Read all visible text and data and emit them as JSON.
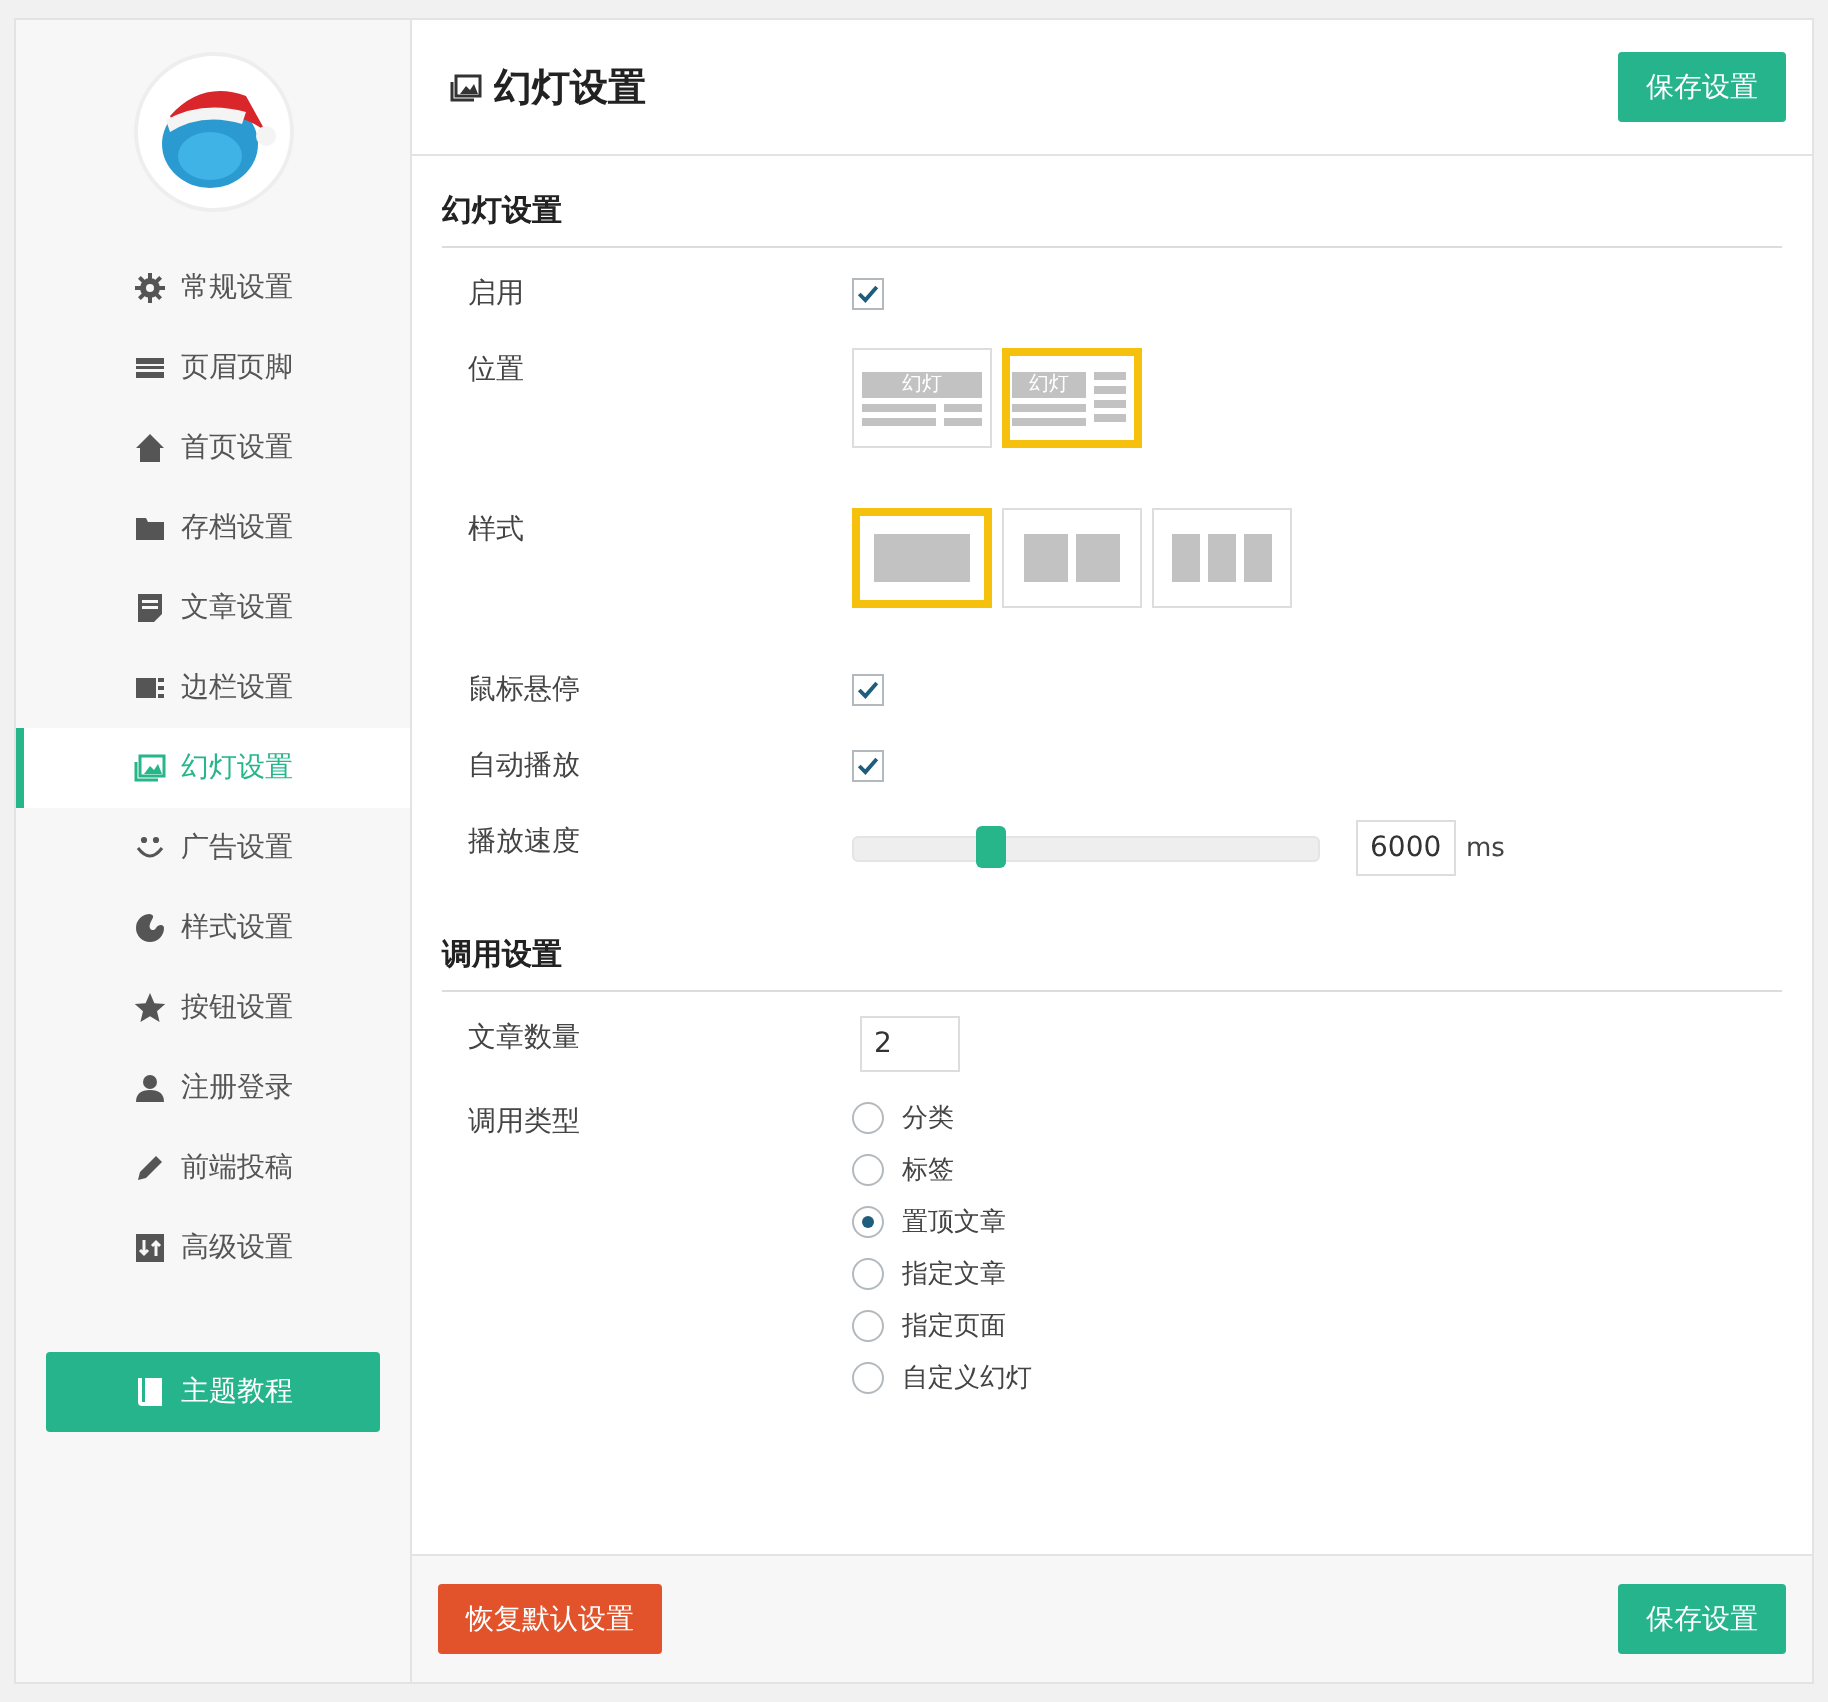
{
  "sidebar": {
    "items": [
      {
        "label": "常规设置",
        "selected": false
      },
      {
        "label": "页眉页脚",
        "selected": false
      },
      {
        "label": "首页设置",
        "selected": false
      },
      {
        "label": "存档设置",
        "selected": false
      },
      {
        "label": "文章设置",
        "selected": false
      },
      {
        "label": "边栏设置",
        "selected": false
      },
      {
        "label": "幻灯设置",
        "selected": true
      },
      {
        "label": "广告设置",
        "selected": false
      },
      {
        "label": "样式设置",
        "selected": false
      },
      {
        "label": "按钮设置",
        "selected": false
      },
      {
        "label": "注册登录",
        "selected": false
      },
      {
        "label": "前端投稿",
        "selected": false
      },
      {
        "label": "高级设置",
        "selected": false
      }
    ],
    "tutorial_button": "主题教程"
  },
  "header": {
    "title": "幻灯设置",
    "save_button": "保存设置"
  },
  "sections": [
    {
      "heading": "幻灯设置",
      "rows": [
        {
          "kind": "checkbox",
          "label": "启用",
          "checked": true
        },
        {
          "kind": "layout",
          "label": "位置",
          "options": [
            {
              "caption": "幻灯",
              "selected": false
            },
            {
              "caption": "幻灯",
              "selected": true
            }
          ]
        },
        {
          "kind": "style",
          "label": "样式",
          "options": [
            {
              "selected": true
            },
            {
              "selected": false
            },
            {
              "selected": false
            }
          ]
        },
        {
          "kind": "checkbox",
          "label": "鼠标悬停",
          "checked": true
        },
        {
          "kind": "checkbox",
          "label": "自动播放",
          "checked": true
        },
        {
          "kind": "slider",
          "label": "播放速度",
          "level": 0.27,
          "value": "6000",
          "unit": "ms"
        }
      ]
    },
    {
      "heading": "调用设置",
      "rows": [
        {
          "kind": "number",
          "label": "文章数量",
          "value": "2"
        },
        {
          "kind": "radio",
          "label": "调用类型",
          "options": [
            {
              "label": "分类",
              "selected": false
            },
            {
              "label": "标签",
              "selected": false
            },
            {
              "label": "置顶文章",
              "selected": true
            },
            {
              "label": "指定文章",
              "selected": false
            },
            {
              "label": "指定页面",
              "selected": false
            },
            {
              "label": "自定义幻灯",
              "selected": false
            }
          ]
        }
      ]
    }
  ],
  "footer": {
    "reset_button": "恢复默认设置",
    "save_button": "保存设置"
  }
}
